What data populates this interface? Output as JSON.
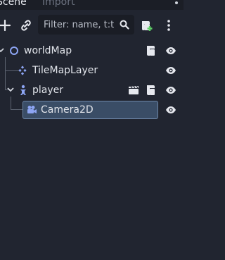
{
  "tabs": {
    "scene_label": "Scene",
    "import_label": "Import"
  },
  "toolbar": {
    "add_icon": "plus-icon",
    "link_icon": "chain-link-icon",
    "filter_placeholder": "Filter: name, t:t",
    "search_icon": "magnifier-icon",
    "script_icon": "add-script-icon",
    "menu_icon": "vertical-dots-icon"
  },
  "tree": {
    "nodes": [
      {
        "label": "worldMap",
        "icon": "node2d-circle-icon",
        "expanded": true,
        "badges": [
          "script-icon"
        ],
        "visible": true
      },
      {
        "label": "TileMapLayer",
        "icon": "tilemap-icon",
        "badges": [],
        "visible": true
      },
      {
        "label": "player",
        "icon": "character-body-icon",
        "expanded": true,
        "badges": [
          "clapperboard-icon",
          "script-icon"
        ],
        "visible": true
      },
      {
        "label": "Camera2D",
        "icon": "camera-icon",
        "selected": true,
        "badges": [],
        "visible": true
      }
    ]
  },
  "colors": {
    "background": "#212530",
    "selection_fill": "#3a4d66",
    "selection_border": "#6d87a8",
    "icon_blue": "#8da5f3",
    "text": "#e1e4ea"
  }
}
